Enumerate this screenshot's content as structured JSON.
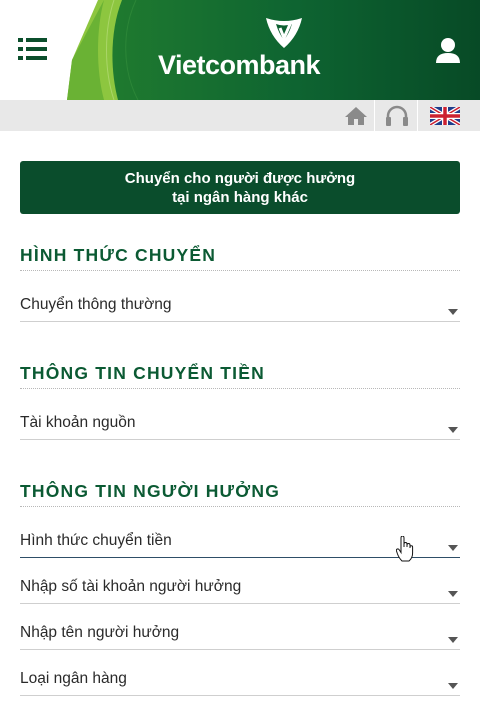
{
  "header": {
    "brand": "Vietcombank",
    "menu_icon": "hamburger-menu-icon",
    "user_icon": "user-icon",
    "colors": {
      "dark_green": "#0b5a2f",
      "light_green": "#8cc63f",
      "white": "#ffffff"
    }
  },
  "toolbar": {
    "items": [
      {
        "icon": "home-icon"
      },
      {
        "icon": "headset-support-icon"
      },
      {
        "icon": "uk-flag-icon"
      }
    ]
  },
  "page": {
    "title_line1": "Chuyển cho người được hưởng",
    "title_line2": "tại ngân hàng khác"
  },
  "sections": {
    "transfer_type": {
      "heading": "HÌNH THỨC CHUYỂN",
      "fields": [
        {
          "label": "Chuyển thông thường"
        }
      ]
    },
    "transfer_info": {
      "heading": "THÔNG TIN CHUYỂN TIỀN",
      "fields": [
        {
          "label": "Tài khoản nguồn"
        }
      ]
    },
    "beneficiary_info": {
      "heading": "THÔNG TIN NGƯỜI HƯỞNG",
      "fields": [
        {
          "label": "Hình thức chuyển tiền"
        },
        {
          "label": "Nhập số tài khoản người hưởng"
        },
        {
          "label": "Nhập tên người hưởng"
        },
        {
          "label": "Loại ngân hàng"
        }
      ]
    }
  }
}
